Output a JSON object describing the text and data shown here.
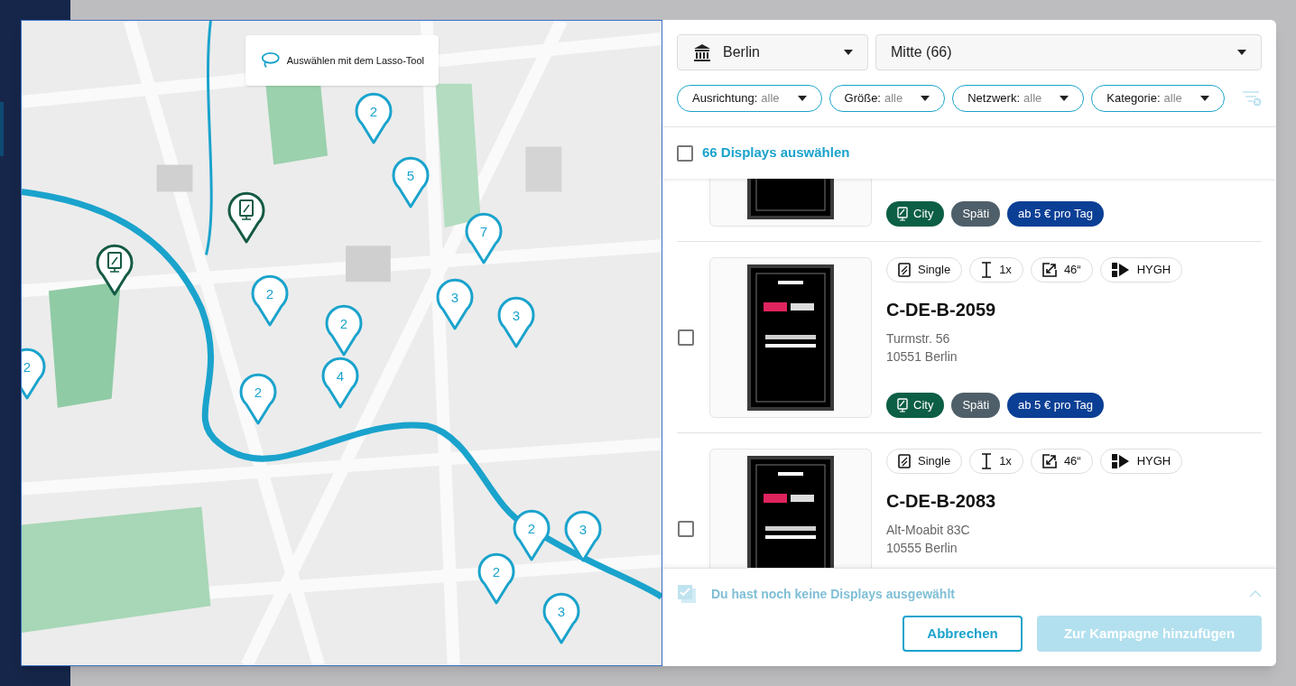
{
  "map": {
    "lasso_hint": "Auswählen mit dem Lasso-Tool",
    "pins": [
      {
        "kind": "cluster",
        "count": "2"
      },
      {
        "kind": "cluster",
        "count": "5"
      },
      {
        "kind": "cluster",
        "count": "7"
      },
      {
        "kind": "cluster",
        "count": "2"
      },
      {
        "kind": "cluster",
        "count": "3"
      },
      {
        "kind": "cluster",
        "count": "3"
      },
      {
        "kind": "cluster",
        "count": "2"
      },
      {
        "kind": "cluster",
        "count": "4"
      },
      {
        "kind": "cluster",
        "count": "2"
      },
      {
        "kind": "cluster",
        "count": "2"
      },
      {
        "kind": "cluster",
        "count": "2"
      },
      {
        "kind": "cluster",
        "count": "3"
      },
      {
        "kind": "cluster",
        "count": "2"
      },
      {
        "kind": "cluster",
        "count": "3"
      },
      {
        "kind": "display"
      },
      {
        "kind": "display"
      }
    ]
  },
  "city_select": {
    "value": "Berlin"
  },
  "district_select": {
    "value": "Mitte (66)"
  },
  "filters": [
    {
      "label": "Ausrichtung:",
      "value": "alle"
    },
    {
      "label": "Größe:",
      "value": "alle"
    },
    {
      "label": "Netzwerk:",
      "value": "alle"
    },
    {
      "label": "Kategorie:",
      "value": "alle"
    }
  ],
  "select_all": {
    "label": "66 Displays auswählen",
    "checked": false
  },
  "displays": [
    {
      "tags": [
        {
          "kind": "type",
          "label": "City"
        },
        {
          "kind": "category",
          "label": "Späti"
        },
        {
          "kind": "price",
          "label": "ab 5 € pro Tag"
        }
      ]
    },
    {
      "checked": false,
      "specs": [
        {
          "kind": "format",
          "label": "Single"
        },
        {
          "kind": "count",
          "label": "1x"
        },
        {
          "kind": "size",
          "label": "46“"
        },
        {
          "kind": "network",
          "label": "HYGH"
        }
      ],
      "id": "C-DE-B-2059",
      "address": [
        "Turmstr. 56",
        "10551 Berlin"
      ],
      "tags": [
        {
          "kind": "type",
          "label": "City"
        },
        {
          "kind": "category",
          "label": "Späti"
        },
        {
          "kind": "price",
          "label": "ab 5 € pro Tag"
        }
      ]
    },
    {
      "checked": false,
      "specs": [
        {
          "kind": "format",
          "label": "Single"
        },
        {
          "kind": "count",
          "label": "1x"
        },
        {
          "kind": "size",
          "label": "46“"
        },
        {
          "kind": "network",
          "label": "HYGH"
        }
      ],
      "id": "C-DE-B-2083",
      "address": [
        "Alt-Moabit 83C",
        "10555 Berlin"
      ]
    }
  ],
  "selection_summary": "Du hast noch keine Displays ausgewählt",
  "buttons": [
    {
      "kind": "secondary",
      "label": "Abbrechen",
      "disabled": false
    },
    {
      "kind": "primary",
      "label": "Zur Kampagne hinzufügen",
      "disabled": true
    }
  ]
}
